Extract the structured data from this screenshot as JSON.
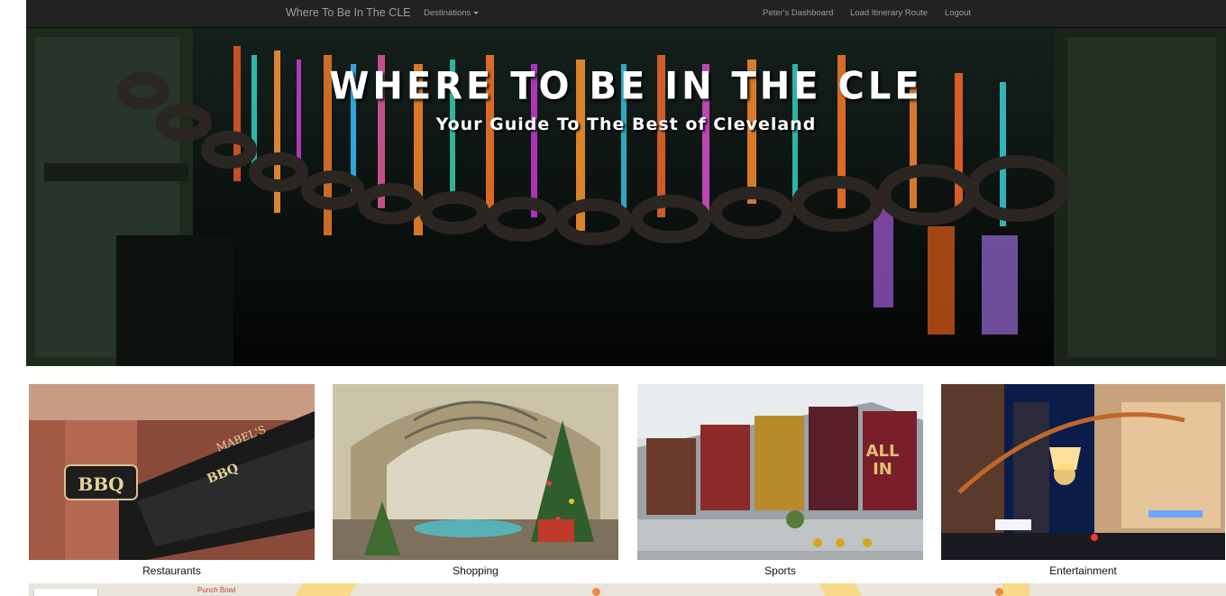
{
  "navbar": {
    "brand": "Where To Be In The CLE",
    "destinations": "Destinations",
    "dashboard": "Peter's Dashboard",
    "load_route": "Load Itinerary Route",
    "logout": "Logout"
  },
  "hero": {
    "title": "WHERE TO BE IN THE CLE",
    "subtitle": "Your Guide To The Best of Cleveland"
  },
  "categories": [
    {
      "label": "Restaurants"
    },
    {
      "label": "Shopping"
    },
    {
      "label": "Sports"
    },
    {
      "label": "Entertainment"
    }
  ],
  "map": {
    "place_label": "Punch Bowl"
  }
}
